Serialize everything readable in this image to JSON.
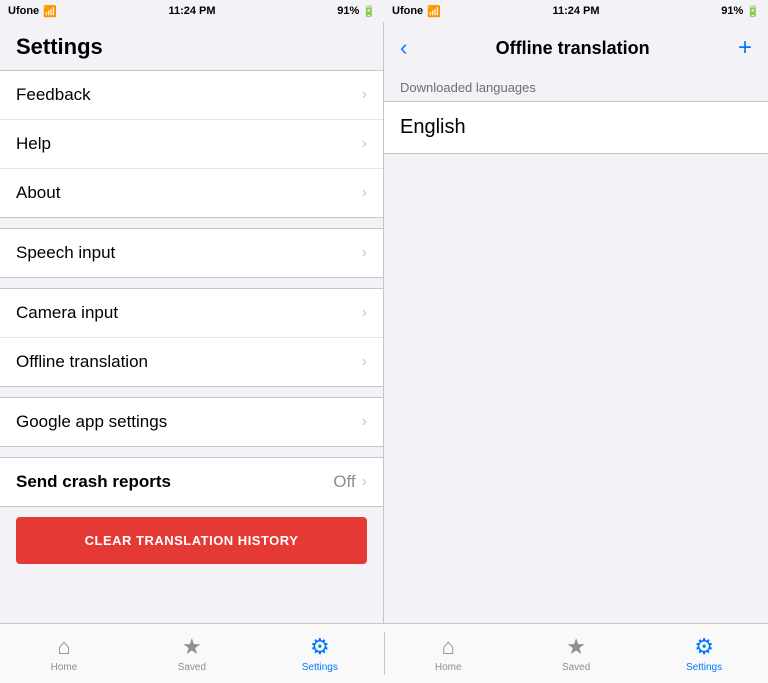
{
  "left_status": {
    "carrier": "Ufone",
    "time": "11:24 PM",
    "battery": "91%"
  },
  "right_status": {
    "carrier": "Ufone",
    "time": "11:24 PM",
    "battery": "91%"
  },
  "left_panel": {
    "title": "Settings",
    "groups": [
      {
        "id": "group1",
        "items": [
          {
            "id": "feedback",
            "label": "Feedback",
            "value": "",
            "chevron": true
          },
          {
            "id": "help",
            "label": "Help",
            "value": "",
            "chevron": true
          },
          {
            "id": "about",
            "label": "About",
            "value": "",
            "chevron": true
          }
        ]
      },
      {
        "id": "group2",
        "items": [
          {
            "id": "speech-input",
            "label": "Speech input",
            "value": "",
            "chevron": true
          }
        ]
      },
      {
        "id": "group3",
        "items": [
          {
            "id": "camera-input",
            "label": "Camera input",
            "value": "",
            "chevron": true
          },
          {
            "id": "offline-translation",
            "label": "Offline translation",
            "value": "",
            "chevron": true,
            "active": true
          }
        ]
      },
      {
        "id": "group4",
        "items": [
          {
            "id": "google-app-settings",
            "label": "Google app settings",
            "value": "",
            "chevron": true
          }
        ]
      },
      {
        "id": "group5",
        "items": [
          {
            "id": "send-crash-reports",
            "label": "Send crash reports",
            "value": "Off",
            "chevron": true,
            "bold": true
          }
        ]
      }
    ],
    "clear_button": "CLEAR TRANSLATION HISTORY"
  },
  "right_panel": {
    "back_label": "‹",
    "title": "Offline translation",
    "add_label": "+",
    "section_header": "Downloaded languages",
    "languages": [
      {
        "id": "english",
        "label": "English"
      }
    ]
  },
  "bottom_nav_left": {
    "items": [
      {
        "id": "home",
        "label": "Home",
        "icon": "⌂",
        "active": false
      },
      {
        "id": "saved",
        "label": "Saved",
        "icon": "★",
        "active": false
      },
      {
        "id": "settings",
        "label": "Settings",
        "icon": "⚙",
        "active": true
      }
    ]
  },
  "bottom_nav_right": {
    "items": [
      {
        "id": "home",
        "label": "Home",
        "icon": "⌂",
        "active": false
      },
      {
        "id": "saved",
        "label": "Saved",
        "icon": "★",
        "active": false
      },
      {
        "id": "settings",
        "label": "Settings",
        "icon": "⚙",
        "active": true
      }
    ]
  }
}
